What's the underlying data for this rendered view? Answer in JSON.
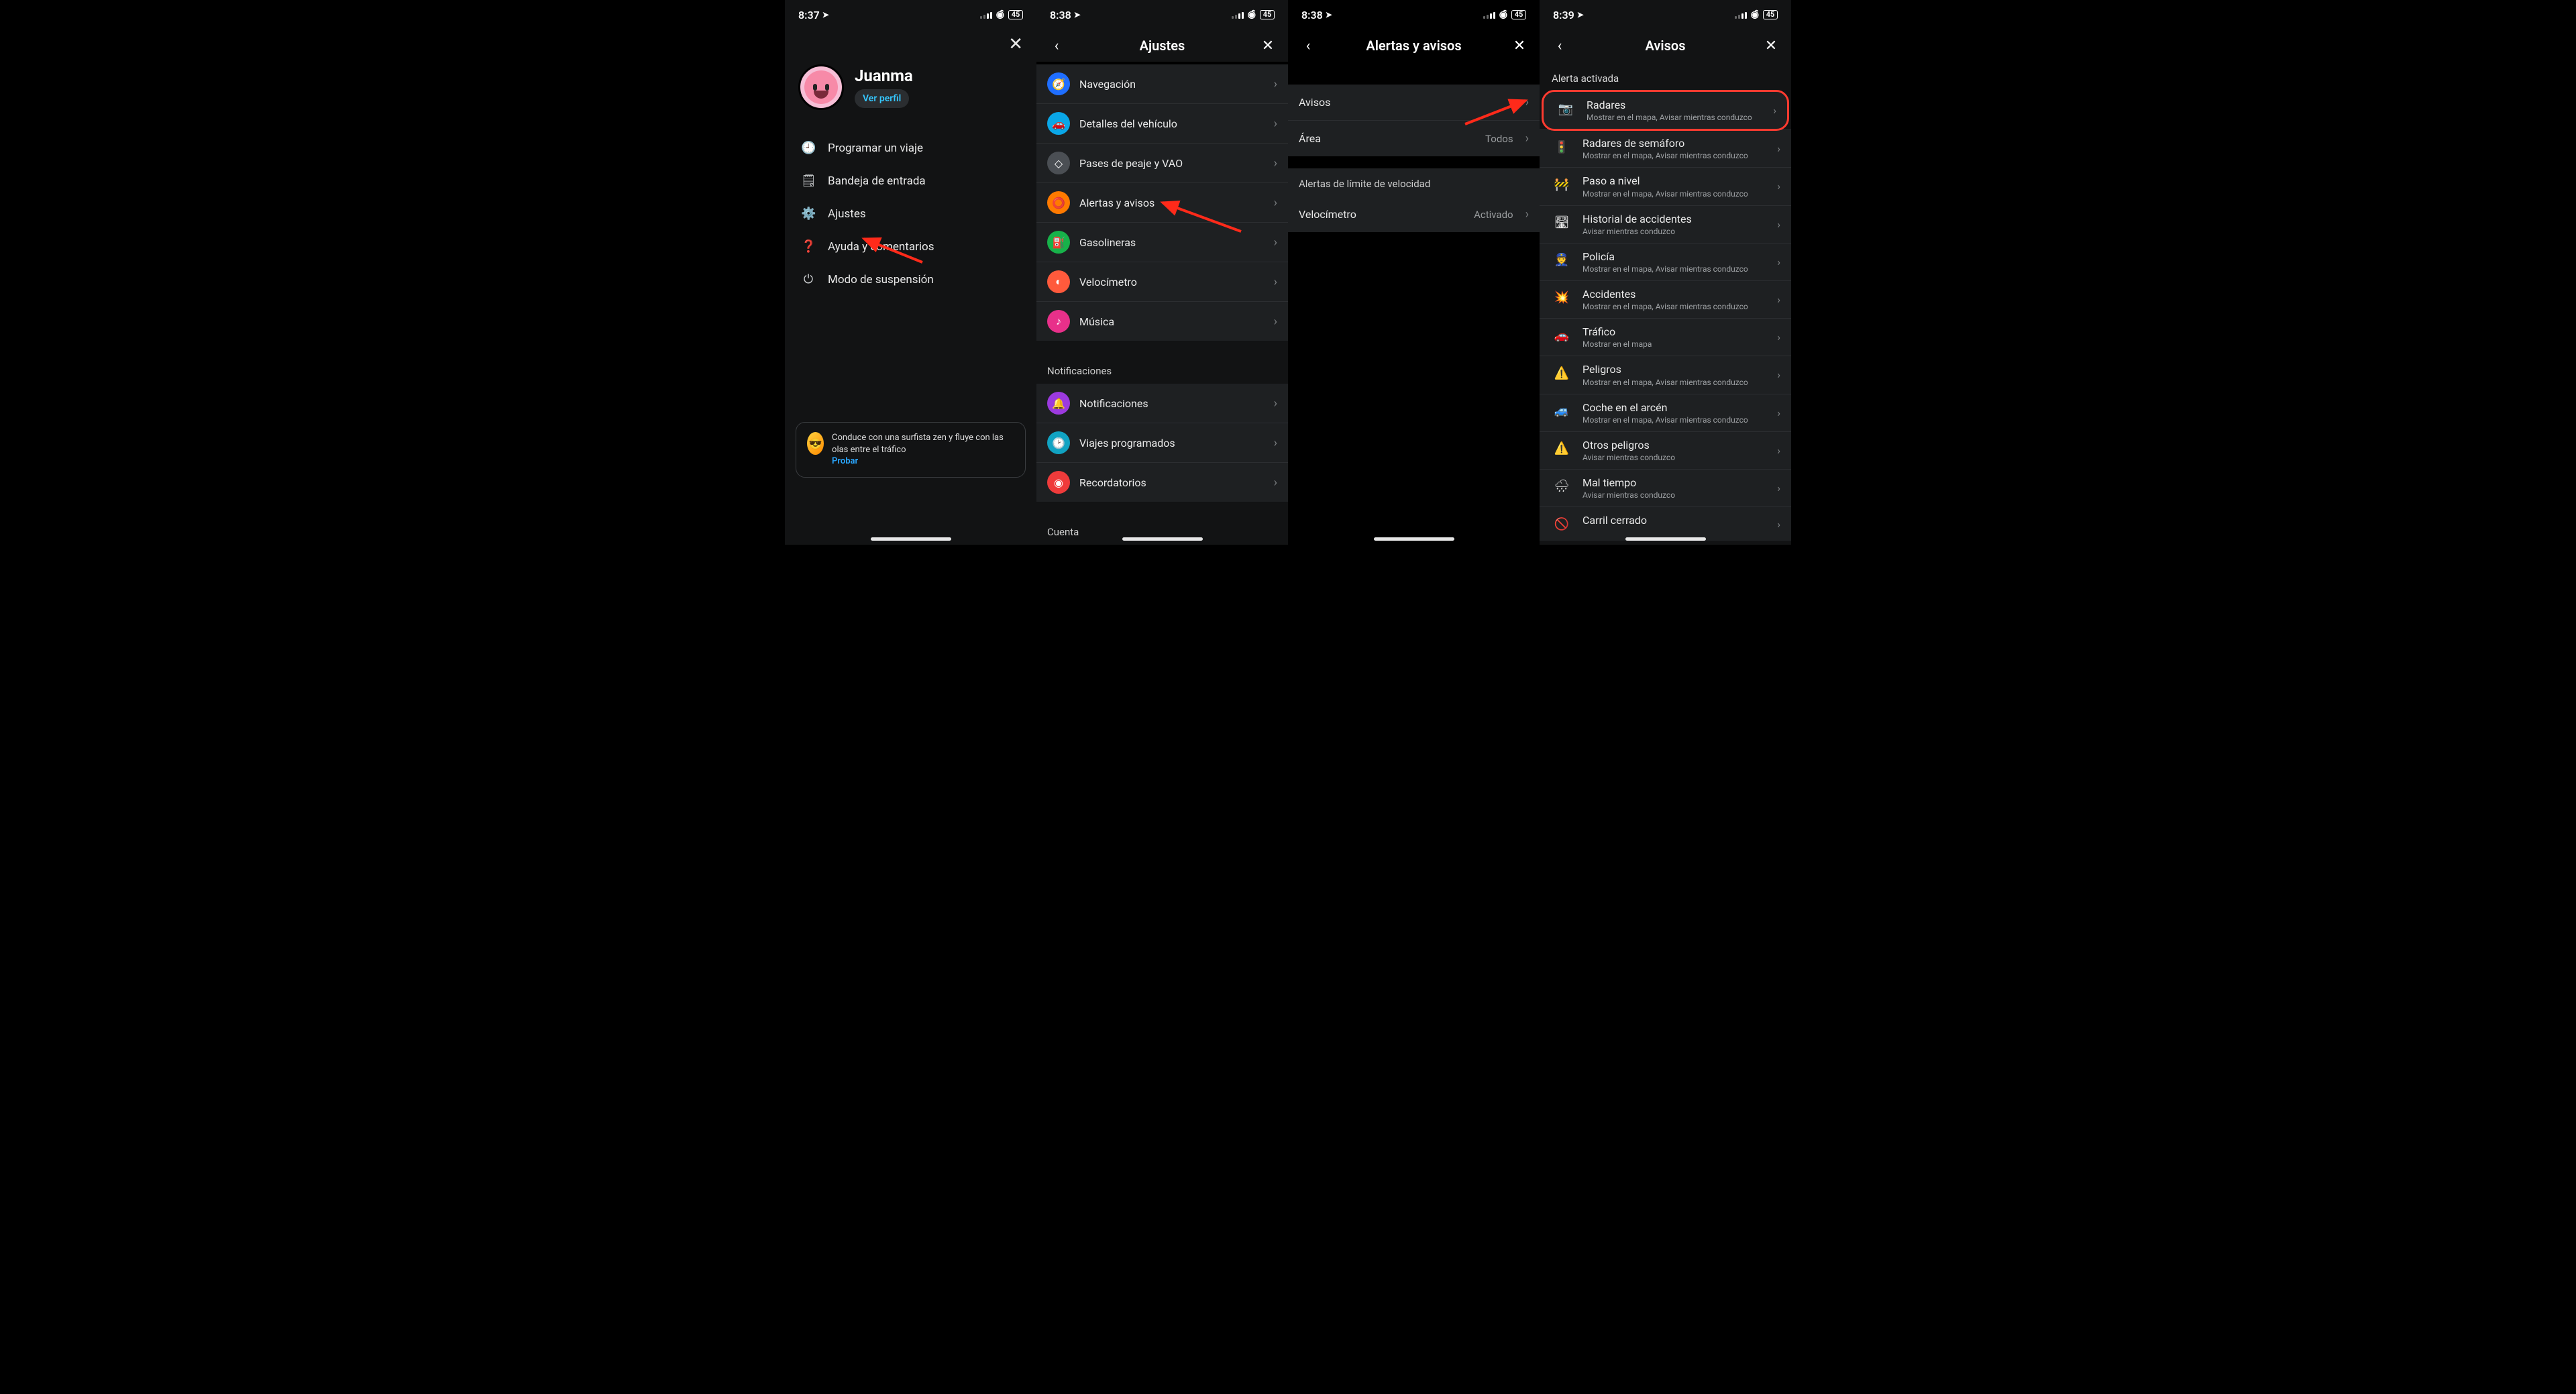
{
  "status": {
    "battery": "45",
    "wifi": "wifi-icon"
  },
  "times": [
    "8:37",
    "8:38",
    "8:38",
    "8:39"
  ],
  "screen1": {
    "username": "Juanma",
    "see_profile": "Ver perfil",
    "menu": [
      {
        "icon": "🕘",
        "label": "Programar un viaje"
      },
      {
        "icon": "🗒",
        "label": "Bandeja de entrada"
      },
      {
        "icon": "⚙️",
        "label": "Ajustes"
      },
      {
        "icon": "❓",
        "label": "Ayuda y comentarios"
      },
      {
        "icon": "⏻",
        "label": "Modo de suspensión"
      }
    ],
    "promo_text": "Conduce con una surfista zen y fluye con las olas entre el tráfico",
    "promo_cta": "Probar"
  },
  "screen2": {
    "title": "Ajustes",
    "rows1": [
      {
        "label": "Navegación",
        "color": "blue",
        "icon": "🧭"
      },
      {
        "label": "Detalles del vehículo",
        "color": "cyan",
        "icon": "🚗"
      },
      {
        "label": "Pases de peaje y VAO",
        "color": "gray",
        "icon": "◇"
      },
      {
        "label": "Alertas y avisos",
        "color": "orange",
        "icon": "⭕"
      },
      {
        "label": "Gasolineras",
        "color": "green",
        "icon": "⛽"
      },
      {
        "label": "Velocímetro",
        "color": "redo",
        "icon": "◐"
      },
      {
        "label": "Música",
        "color": "pink",
        "icon": "♪"
      }
    ],
    "section2_title": "Notificaciones",
    "rows2": [
      {
        "label": "Notificaciones",
        "color": "purple",
        "icon": "🔔"
      },
      {
        "label": "Viajes programados",
        "color": "teal",
        "icon": "🕑"
      },
      {
        "label": "Recordatorios",
        "color": "red",
        "icon": "◉"
      }
    ],
    "section3_title": "Cuenta"
  },
  "screen3": {
    "title": "Alertas y avisos",
    "rows1": [
      {
        "label": "Avisos",
        "value": ""
      },
      {
        "label": "Área",
        "value": "Todos"
      }
    ],
    "section2": "Alertas de límite de velocidad",
    "rows2": [
      {
        "label": "Velocímetro",
        "value": "Activado"
      }
    ]
  },
  "screen4": {
    "title": "Avisos",
    "section": "Alerta activada",
    "items": [
      {
        "title": "Radares",
        "sub": "Mostrar en el mapa, Avisar mientras conduzco",
        "icon": "📷",
        "hl": true
      },
      {
        "title": "Radares de semáforo",
        "sub": "Mostrar en el mapa, Avisar mientras conduzco",
        "icon": "🚦"
      },
      {
        "title": "Paso a nivel",
        "sub": "Mostrar en el mapa, Avisar mientras conduzco",
        "icon": "🚧"
      },
      {
        "title": "Historial de accidentes",
        "sub": "Avisar mientras conduzco",
        "icon": "🛣"
      },
      {
        "title": "Policía",
        "sub": "Mostrar en el mapa, Avisar mientras conduzco",
        "icon": "👮"
      },
      {
        "title": "Accidentes",
        "sub": "Mostrar en el mapa, Avisar mientras conduzco",
        "icon": "💥"
      },
      {
        "title": "Tráfico",
        "sub": "Mostrar en el mapa",
        "icon": "🚗"
      },
      {
        "title": "Peligros",
        "sub": "Mostrar en el mapa, Avisar mientras conduzco",
        "icon": "⚠️"
      },
      {
        "title": "Coche en el arcén",
        "sub": "Mostrar en el mapa, Avisar mientras conduzco",
        "icon": "🚙"
      },
      {
        "title": "Otros peligros",
        "sub": "Avisar mientras conduzco",
        "icon": "⚠️"
      },
      {
        "title": "Mal tiempo",
        "sub": "Avisar mientras conduzco",
        "icon": "🌧"
      },
      {
        "title": "Carril cerrado",
        "sub": "",
        "icon": "🚫"
      }
    ]
  }
}
